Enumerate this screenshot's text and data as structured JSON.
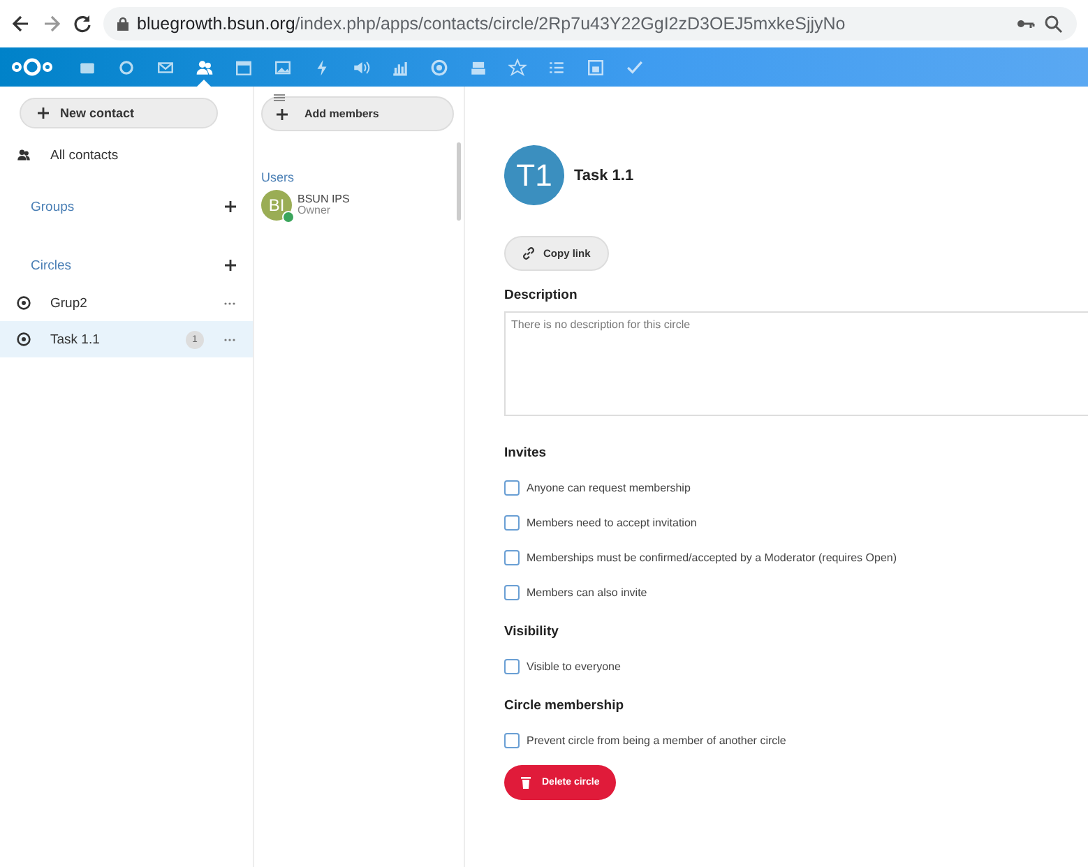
{
  "browser": {
    "url_host": "bluegrowth.bsun.org",
    "url_path": "/index.php/apps/contacts/circle/2Rp7u43Y22GgI2zD3OEJ5mxkeSjjyNo"
  },
  "app_nav": [
    {
      "selected": false
    },
    {
      "selected": false
    },
    {
      "selected": false
    },
    {
      "selected": true
    },
    {
      "selected": false
    },
    {
      "selected": false
    },
    {
      "selected": false
    },
    {
      "selected": false
    },
    {
      "selected": false
    },
    {
      "selected": false
    },
    {
      "selected": false
    },
    {
      "selected": false
    },
    {
      "selected": false
    },
    {
      "selected": false
    },
    {
      "selected": false
    }
  ],
  "sidebar": {
    "new_contact": "New contact",
    "all_contacts": "All contacts",
    "groups": "Groups",
    "circles": "Circles",
    "items": [
      {
        "label": "Grup2",
        "selected": false
      },
      {
        "label": "Task 1.1",
        "count": "1",
        "selected": true
      }
    ]
  },
  "members": {
    "add_button": "Add members",
    "section": "Users",
    "list": [
      {
        "initials": "BI",
        "name": "BSUN IPS",
        "role": "Owner",
        "online": true
      }
    ]
  },
  "circle": {
    "initials": "T1",
    "title": "Task 1.1",
    "copy_link": "Copy link",
    "description_heading": "Description",
    "description_placeholder": "There is no description for this circle",
    "sections": [
      {
        "title": "Invites",
        "options": [
          {
            "label": "Anyone can request membership",
            "checked": false
          },
          {
            "label": "Members need to accept invitation",
            "checked": false
          },
          {
            "label": "Memberships must be confirmed/accepted by a Moderator (requires Open)",
            "checked": false
          },
          {
            "label": "Members can also invite",
            "checked": false
          }
        ]
      },
      {
        "title": "Visibility",
        "options": [
          {
            "label": "Visible to everyone",
            "checked": false
          }
        ]
      },
      {
        "title": "Circle membership",
        "options": [
          {
            "label": "Prevent circle from being a member of another circle",
            "checked": false
          }
        ]
      }
    ],
    "delete_button": "Delete circle"
  }
}
